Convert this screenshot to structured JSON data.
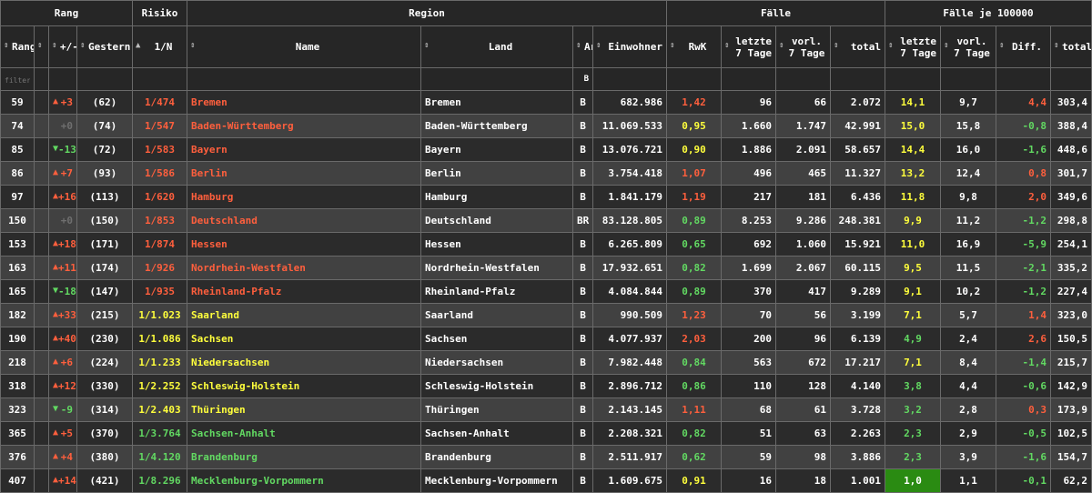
{
  "groups": [
    "Rang",
    "Risiko",
    "Region",
    "Fälle",
    "Fälle je 100000"
  ],
  "headers": {
    "rang": [
      "Rang"
    ],
    "sort": [
      ""
    ],
    "change": [
      "+/-"
    ],
    "gestern": [
      "Gestern"
    ],
    "risiko": [
      "1/N"
    ],
    "name": [
      "Name"
    ],
    "land": [
      "Land"
    ],
    "art": [
      "Art"
    ],
    "einwohner": [
      "Einwohner"
    ],
    "rwk": [
      "RwK"
    ],
    "letzte": [
      "letzte",
      "7 Tage"
    ],
    "vorl": [
      "vorl.",
      "7 Tage"
    ],
    "total": [
      "total"
    ],
    "p_letzte": [
      "letzte",
      "7 Tage"
    ],
    "p_vorl": [
      "vorl.",
      "7 Tage"
    ],
    "diff": [
      "Diff."
    ],
    "p_total": [
      "total"
    ]
  },
  "filter": {
    "placeholder": "filter column...",
    "art_value": "B"
  },
  "colors": {
    "red": "#ff5f3d",
    "yellow": "#ffff3c",
    "green": "#62d962",
    "highlight_bg": "#2a8b12",
    "row_dark": "#2b2b2b",
    "row_light": "#414141"
  },
  "rows": [
    {
      "rang": "59",
      "dir": "up",
      "chg": "+3",
      "gestern": "(62)",
      "risiko": "1/474",
      "risiko_color": "red",
      "name": "Bremen",
      "land": "Bremen",
      "art": "B",
      "einwohner": "682.986",
      "rwk": "1,42",
      "rwk_color": "red",
      "letzte": "96",
      "vorl": "66",
      "total": "2.072",
      "p_letzte": "14,1",
      "p_letzte_color": "yel",
      "p_vorl": "9,7",
      "diff": "4,4",
      "diff_color": "red",
      "p_total": "303,4"
    },
    {
      "rang": "74",
      "dir": "none",
      "chg": "+0",
      "gestern": "(74)",
      "risiko": "1/547",
      "risiko_color": "red",
      "name": "Baden-Württemberg",
      "land": "Baden-Württemberg",
      "art": "B",
      "einwohner": "11.069.533",
      "rwk": "0,95",
      "rwk_color": "yel",
      "letzte": "1.660",
      "vorl": "1.747",
      "total": "42.991",
      "p_letzte": "15,0",
      "p_letzte_color": "yel",
      "p_vorl": "15,8",
      "diff": "-0,8",
      "diff_color": "grn",
      "p_total": "388,4"
    },
    {
      "rang": "85",
      "dir": "down",
      "chg": "-13",
      "gestern": "(72)",
      "risiko": "1/583",
      "risiko_color": "red",
      "name": "Bayern",
      "land": "Bayern",
      "art": "B",
      "einwohner": "13.076.721",
      "rwk": "0,90",
      "rwk_color": "yel",
      "letzte": "1.886",
      "vorl": "2.091",
      "total": "58.657",
      "p_letzte": "14,4",
      "p_letzte_color": "yel",
      "p_vorl": "16,0",
      "diff": "-1,6",
      "diff_color": "grn",
      "p_total": "448,6"
    },
    {
      "rang": "86",
      "dir": "up",
      "chg": "+7",
      "gestern": "(93)",
      "risiko": "1/586",
      "risiko_color": "red",
      "name": "Berlin",
      "land": "Berlin",
      "art": "B",
      "einwohner": "3.754.418",
      "rwk": "1,07",
      "rwk_color": "red",
      "letzte": "496",
      "vorl": "465",
      "total": "11.327",
      "p_letzte": "13,2",
      "p_letzte_color": "yel",
      "p_vorl": "12,4",
      "diff": "0,8",
      "diff_color": "red",
      "p_total": "301,7"
    },
    {
      "rang": "97",
      "dir": "up",
      "chg": "+16",
      "gestern": "(113)",
      "risiko": "1/620",
      "risiko_color": "red",
      "name": "Hamburg",
      "land": "Hamburg",
      "art": "B",
      "einwohner": "1.841.179",
      "rwk": "1,19",
      "rwk_color": "red",
      "letzte": "217",
      "vorl": "181",
      "total": "6.436",
      "p_letzte": "11,8",
      "p_letzte_color": "yel",
      "p_vorl": "9,8",
      "diff": "2,0",
      "diff_color": "red",
      "p_total": "349,6"
    },
    {
      "rang": "150",
      "dir": "none",
      "chg": "+0",
      "gestern": "(150)",
      "risiko": "1/853",
      "risiko_color": "red",
      "name": "Deutschland",
      "land": "Deutschland",
      "art": "BR",
      "einwohner": "83.128.805",
      "rwk": "0,89",
      "rwk_color": "grn",
      "letzte": "8.253",
      "vorl": "9.286",
      "total": "248.381",
      "p_letzte": "9,9",
      "p_letzte_color": "yel",
      "p_vorl": "11,2",
      "diff": "-1,2",
      "diff_color": "grn",
      "p_total": "298,8"
    },
    {
      "rang": "153",
      "dir": "up",
      "chg": "+18",
      "gestern": "(171)",
      "risiko": "1/874",
      "risiko_color": "red",
      "name": "Hessen",
      "land": "Hessen",
      "art": "B",
      "einwohner": "6.265.809",
      "rwk": "0,65",
      "rwk_color": "grn",
      "letzte": "692",
      "vorl": "1.060",
      "total": "15.921",
      "p_letzte": "11,0",
      "p_letzte_color": "yel",
      "p_vorl": "16,9",
      "diff": "-5,9",
      "diff_color": "grn",
      "p_total": "254,1"
    },
    {
      "rang": "163",
      "dir": "up",
      "chg": "+11",
      "gestern": "(174)",
      "risiko": "1/926",
      "risiko_color": "red",
      "name": "Nordrhein-Westfalen",
      "land": "Nordrhein-Westfalen",
      "art": "B",
      "einwohner": "17.932.651",
      "rwk": "0,82",
      "rwk_color": "grn",
      "letzte": "1.699",
      "vorl": "2.067",
      "total": "60.115",
      "p_letzte": "9,5",
      "p_letzte_color": "yel",
      "p_vorl": "11,5",
      "diff": "-2,1",
      "diff_color": "grn",
      "p_total": "335,2"
    },
    {
      "rang": "165",
      "dir": "down",
      "chg": "-18",
      "gestern": "(147)",
      "risiko": "1/935",
      "risiko_color": "red",
      "name": "Rheinland-Pfalz",
      "land": "Rheinland-Pfalz",
      "art": "B",
      "einwohner": "4.084.844",
      "rwk": "0,89",
      "rwk_color": "grn",
      "letzte": "370",
      "vorl": "417",
      "total": "9.289",
      "p_letzte": "9,1",
      "p_letzte_color": "yel",
      "p_vorl": "10,2",
      "diff": "-1,2",
      "diff_color": "grn",
      "p_total": "227,4"
    },
    {
      "rang": "182",
      "dir": "up",
      "chg": "+33",
      "gestern": "(215)",
      "risiko": "1/1.023",
      "risiko_color": "yel",
      "name": "Saarland",
      "land": "Saarland",
      "art": "B",
      "einwohner": "990.509",
      "rwk": "1,23",
      "rwk_color": "red",
      "letzte": "70",
      "vorl": "56",
      "total": "3.199",
      "p_letzte": "7,1",
      "p_letzte_color": "yel",
      "p_vorl": "5,7",
      "diff": "1,4",
      "diff_color": "red",
      "p_total": "323,0"
    },
    {
      "rang": "190",
      "dir": "up",
      "chg": "+40",
      "gestern": "(230)",
      "risiko": "1/1.086",
      "risiko_color": "yel",
      "name": "Sachsen",
      "land": "Sachsen",
      "art": "B",
      "einwohner": "4.077.937",
      "rwk": "2,03",
      "rwk_color": "red",
      "letzte": "200",
      "vorl": "96",
      "total": "6.139",
      "p_letzte": "4,9",
      "p_letzte_color": "grn",
      "p_vorl": "2,4",
      "diff": "2,6",
      "diff_color": "red",
      "p_total": "150,5"
    },
    {
      "rang": "218",
      "dir": "up",
      "chg": "+6",
      "gestern": "(224)",
      "risiko": "1/1.233",
      "risiko_color": "yel",
      "name": "Niedersachsen",
      "land": "Niedersachsen",
      "art": "B",
      "einwohner": "7.982.448",
      "rwk": "0,84",
      "rwk_color": "grn",
      "letzte": "563",
      "vorl": "672",
      "total": "17.217",
      "p_letzte": "7,1",
      "p_letzte_color": "yel",
      "p_vorl": "8,4",
      "diff": "-1,4",
      "diff_color": "grn",
      "p_total": "215,7"
    },
    {
      "rang": "318",
      "dir": "up",
      "chg": "+12",
      "gestern": "(330)",
      "risiko": "1/2.252",
      "risiko_color": "yel",
      "name": "Schleswig-Holstein",
      "land": "Schleswig-Holstein",
      "art": "B",
      "einwohner": "2.896.712",
      "rwk": "0,86",
      "rwk_color": "grn",
      "letzte": "110",
      "vorl": "128",
      "total": "4.140",
      "p_letzte": "3,8",
      "p_letzte_color": "grn",
      "p_vorl": "4,4",
      "diff": "-0,6",
      "diff_color": "grn",
      "p_total": "142,9"
    },
    {
      "rang": "323",
      "dir": "down",
      "chg": "-9",
      "gestern": "(314)",
      "risiko": "1/2.403",
      "risiko_color": "yel",
      "name": "Thüringen",
      "land": "Thüringen",
      "art": "B",
      "einwohner": "2.143.145",
      "rwk": "1,11",
      "rwk_color": "red",
      "letzte": "68",
      "vorl": "61",
      "total": "3.728",
      "p_letzte": "3,2",
      "p_letzte_color": "grn",
      "p_vorl": "2,8",
      "diff": "0,3",
      "diff_color": "red",
      "p_total": "173,9"
    },
    {
      "rang": "365",
      "dir": "up",
      "chg": "+5",
      "gestern": "(370)",
      "risiko": "1/3.764",
      "risiko_color": "grn",
      "name": "Sachsen-Anhalt",
      "land": "Sachsen-Anhalt",
      "art": "B",
      "einwohner": "2.208.321",
      "rwk": "0,82",
      "rwk_color": "grn",
      "letzte": "51",
      "vorl": "63",
      "total": "2.263",
      "p_letzte": "2,3",
      "p_letzte_color": "grn",
      "p_vorl": "2,9",
      "diff": "-0,5",
      "diff_color": "grn",
      "p_total": "102,5"
    },
    {
      "rang": "376",
      "dir": "up",
      "chg": "+4",
      "gestern": "(380)",
      "risiko": "1/4.120",
      "risiko_color": "grn",
      "name": "Brandenburg",
      "land": "Brandenburg",
      "art": "B",
      "einwohner": "2.511.917",
      "rwk": "0,62",
      "rwk_color": "grn",
      "letzte": "59",
      "vorl": "98",
      "total": "3.886",
      "p_letzte": "2,3",
      "p_letzte_color": "grn",
      "p_vorl": "3,9",
      "diff": "-1,6",
      "diff_color": "grn",
      "p_total": "154,7"
    },
    {
      "rang": "407",
      "dir": "up",
      "chg": "+14",
      "gestern": "(421)",
      "risiko": "1/8.296",
      "risiko_color": "grn",
      "name": "Mecklenburg-Vorpommern",
      "land": "Mecklenburg-Vorpommern",
      "art": "B",
      "einwohner": "1.609.675",
      "rwk": "0,91",
      "rwk_color": "yel",
      "letzte": "16",
      "vorl": "18",
      "total": "1.001",
      "p_letzte": "1,0",
      "p_letzte_color": "hl",
      "p_vorl": "1,1",
      "diff": "-0,1",
      "diff_color": "grn",
      "p_total": "62,2"
    }
  ]
}
